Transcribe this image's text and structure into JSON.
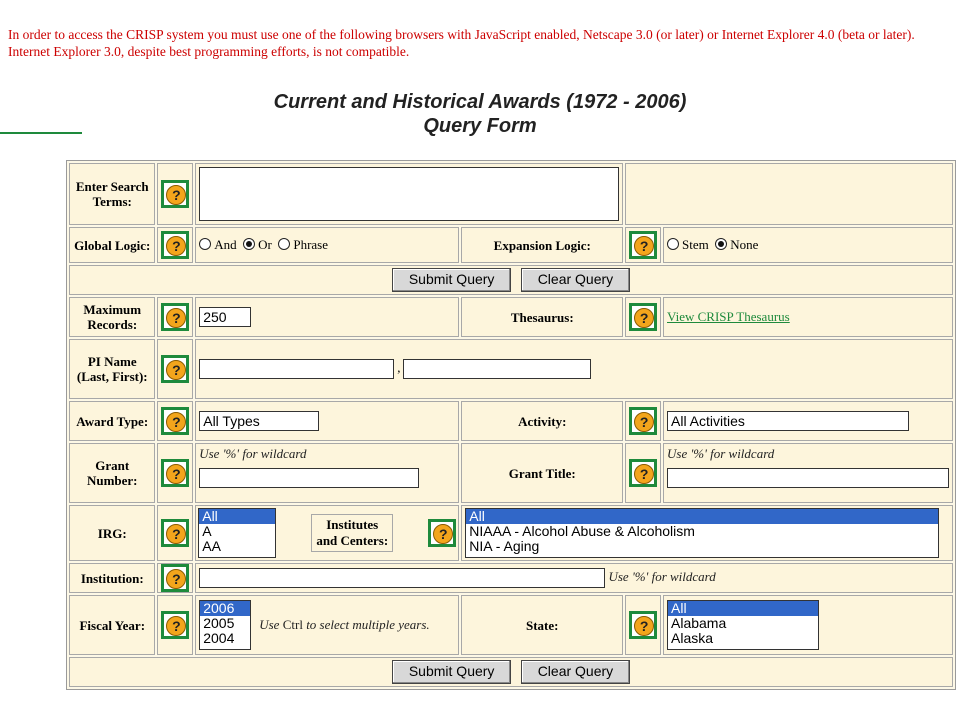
{
  "notice": "In order to access the CRISP system you must use one of the following browsers with JavaScript enabled, Netscape 3.0 (or later) or Internet Explorer 4.0 (beta or later). Internet Explorer 3.0, despite best programming efforts, is not compatible.",
  "title_line1": "Current and Historical Awards (1972 - 2006)",
  "title_line2": "Query Form",
  "help_glyph": "?",
  "labels": {
    "search_terms": "Enter Search Terms:",
    "global_logic": "Global Logic:",
    "expansion_logic": "Expansion Logic:",
    "max_records": "Maximum Records:",
    "thesaurus": "Thesaurus:",
    "pi_name": "PI Name (Last, First):",
    "award_type": "Award Type:",
    "activity": "Activity:",
    "grant_number": "Grant Number:",
    "grant_title": "Grant Title:",
    "irg": "IRG:",
    "institutes": "Institutes and Centers:",
    "institution": "Institution:",
    "fiscal_year": "Fiscal Year:",
    "state": "State:"
  },
  "global_logic_options": [
    "And",
    "Or",
    "Phrase"
  ],
  "global_logic_selected": "Or",
  "expansion_options": [
    "Stem",
    "None"
  ],
  "expansion_selected": "None",
  "buttons": {
    "submit": "Submit Query",
    "clear": "Clear Query"
  },
  "max_records_value": "250",
  "pi_separator": ",",
  "thesaurus_link": "View CRISP Thesaurus",
  "award_type_value": "All Types",
  "activity_value": "All Activities",
  "wildcard_hint": "Use '%' for wildcard",
  "irg_options": [
    "All",
    "A",
    "AA"
  ],
  "institutes_options": [
    "All",
    "NIAAA - Alcohol Abuse & Alcoholism",
    "NIA - Aging"
  ],
  "fiscal_year_options": [
    "2006",
    "2005",
    "2004"
  ],
  "fiscal_year_hint_pre": "Use ",
  "fiscal_year_hint_ctrl": "Ctrl",
  "fiscal_year_hint_post": " to select multiple years.",
  "state_options": [
    "All",
    "Alabama",
    "Alaska"
  ],
  "colors": {
    "notice": "#cc0000",
    "accent": "#1e8a3c",
    "selection": "#3167c8",
    "panel": "#fdf5dc"
  }
}
